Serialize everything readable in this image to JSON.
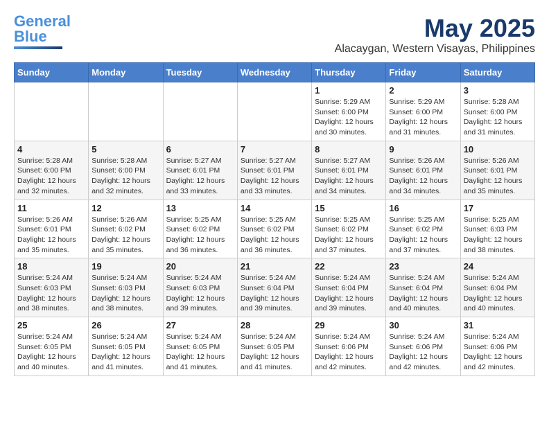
{
  "logo": {
    "line1": "General",
    "line2": "Blue"
  },
  "title": "May 2025",
  "subtitle": "Alacaygan, Western Visayas, Philippines",
  "headers": [
    "Sunday",
    "Monday",
    "Tuesday",
    "Wednesday",
    "Thursday",
    "Friday",
    "Saturday"
  ],
  "weeks": [
    [
      {
        "day": "",
        "info": ""
      },
      {
        "day": "",
        "info": ""
      },
      {
        "day": "",
        "info": ""
      },
      {
        "day": "",
        "info": ""
      },
      {
        "day": "1",
        "info": "Sunrise: 5:29 AM\nSunset: 6:00 PM\nDaylight: 12 hours\nand 30 minutes."
      },
      {
        "day": "2",
        "info": "Sunrise: 5:29 AM\nSunset: 6:00 PM\nDaylight: 12 hours\nand 31 minutes."
      },
      {
        "day": "3",
        "info": "Sunrise: 5:28 AM\nSunset: 6:00 PM\nDaylight: 12 hours\nand 31 minutes."
      }
    ],
    [
      {
        "day": "4",
        "info": "Sunrise: 5:28 AM\nSunset: 6:00 PM\nDaylight: 12 hours\nand 32 minutes."
      },
      {
        "day": "5",
        "info": "Sunrise: 5:28 AM\nSunset: 6:00 PM\nDaylight: 12 hours\nand 32 minutes."
      },
      {
        "day": "6",
        "info": "Sunrise: 5:27 AM\nSunset: 6:01 PM\nDaylight: 12 hours\nand 33 minutes."
      },
      {
        "day": "7",
        "info": "Sunrise: 5:27 AM\nSunset: 6:01 PM\nDaylight: 12 hours\nand 33 minutes."
      },
      {
        "day": "8",
        "info": "Sunrise: 5:27 AM\nSunset: 6:01 PM\nDaylight: 12 hours\nand 34 minutes."
      },
      {
        "day": "9",
        "info": "Sunrise: 5:26 AM\nSunset: 6:01 PM\nDaylight: 12 hours\nand 34 minutes."
      },
      {
        "day": "10",
        "info": "Sunrise: 5:26 AM\nSunset: 6:01 PM\nDaylight: 12 hours\nand 35 minutes."
      }
    ],
    [
      {
        "day": "11",
        "info": "Sunrise: 5:26 AM\nSunset: 6:01 PM\nDaylight: 12 hours\nand 35 minutes."
      },
      {
        "day": "12",
        "info": "Sunrise: 5:26 AM\nSunset: 6:02 PM\nDaylight: 12 hours\nand 35 minutes."
      },
      {
        "day": "13",
        "info": "Sunrise: 5:25 AM\nSunset: 6:02 PM\nDaylight: 12 hours\nand 36 minutes."
      },
      {
        "day": "14",
        "info": "Sunrise: 5:25 AM\nSunset: 6:02 PM\nDaylight: 12 hours\nand 36 minutes."
      },
      {
        "day": "15",
        "info": "Sunrise: 5:25 AM\nSunset: 6:02 PM\nDaylight: 12 hours\nand 37 minutes."
      },
      {
        "day": "16",
        "info": "Sunrise: 5:25 AM\nSunset: 6:02 PM\nDaylight: 12 hours\nand 37 minutes."
      },
      {
        "day": "17",
        "info": "Sunrise: 5:25 AM\nSunset: 6:03 PM\nDaylight: 12 hours\nand 38 minutes."
      }
    ],
    [
      {
        "day": "18",
        "info": "Sunrise: 5:24 AM\nSunset: 6:03 PM\nDaylight: 12 hours\nand 38 minutes."
      },
      {
        "day": "19",
        "info": "Sunrise: 5:24 AM\nSunset: 6:03 PM\nDaylight: 12 hours\nand 38 minutes."
      },
      {
        "day": "20",
        "info": "Sunrise: 5:24 AM\nSunset: 6:03 PM\nDaylight: 12 hours\nand 39 minutes."
      },
      {
        "day": "21",
        "info": "Sunrise: 5:24 AM\nSunset: 6:04 PM\nDaylight: 12 hours\nand 39 minutes."
      },
      {
        "day": "22",
        "info": "Sunrise: 5:24 AM\nSunset: 6:04 PM\nDaylight: 12 hours\nand 39 minutes."
      },
      {
        "day": "23",
        "info": "Sunrise: 5:24 AM\nSunset: 6:04 PM\nDaylight: 12 hours\nand 40 minutes."
      },
      {
        "day": "24",
        "info": "Sunrise: 5:24 AM\nSunset: 6:04 PM\nDaylight: 12 hours\nand 40 minutes."
      }
    ],
    [
      {
        "day": "25",
        "info": "Sunrise: 5:24 AM\nSunset: 6:05 PM\nDaylight: 12 hours\nand 40 minutes."
      },
      {
        "day": "26",
        "info": "Sunrise: 5:24 AM\nSunset: 6:05 PM\nDaylight: 12 hours\nand 41 minutes."
      },
      {
        "day": "27",
        "info": "Sunrise: 5:24 AM\nSunset: 6:05 PM\nDaylight: 12 hours\nand 41 minutes."
      },
      {
        "day": "28",
        "info": "Sunrise: 5:24 AM\nSunset: 6:05 PM\nDaylight: 12 hours\nand 41 minutes."
      },
      {
        "day": "29",
        "info": "Sunrise: 5:24 AM\nSunset: 6:06 PM\nDaylight: 12 hours\nand 42 minutes."
      },
      {
        "day": "30",
        "info": "Sunrise: 5:24 AM\nSunset: 6:06 PM\nDaylight: 12 hours\nand 42 minutes."
      },
      {
        "day": "31",
        "info": "Sunrise: 5:24 AM\nSunset: 6:06 PM\nDaylight: 12 hours\nand 42 minutes."
      }
    ]
  ]
}
